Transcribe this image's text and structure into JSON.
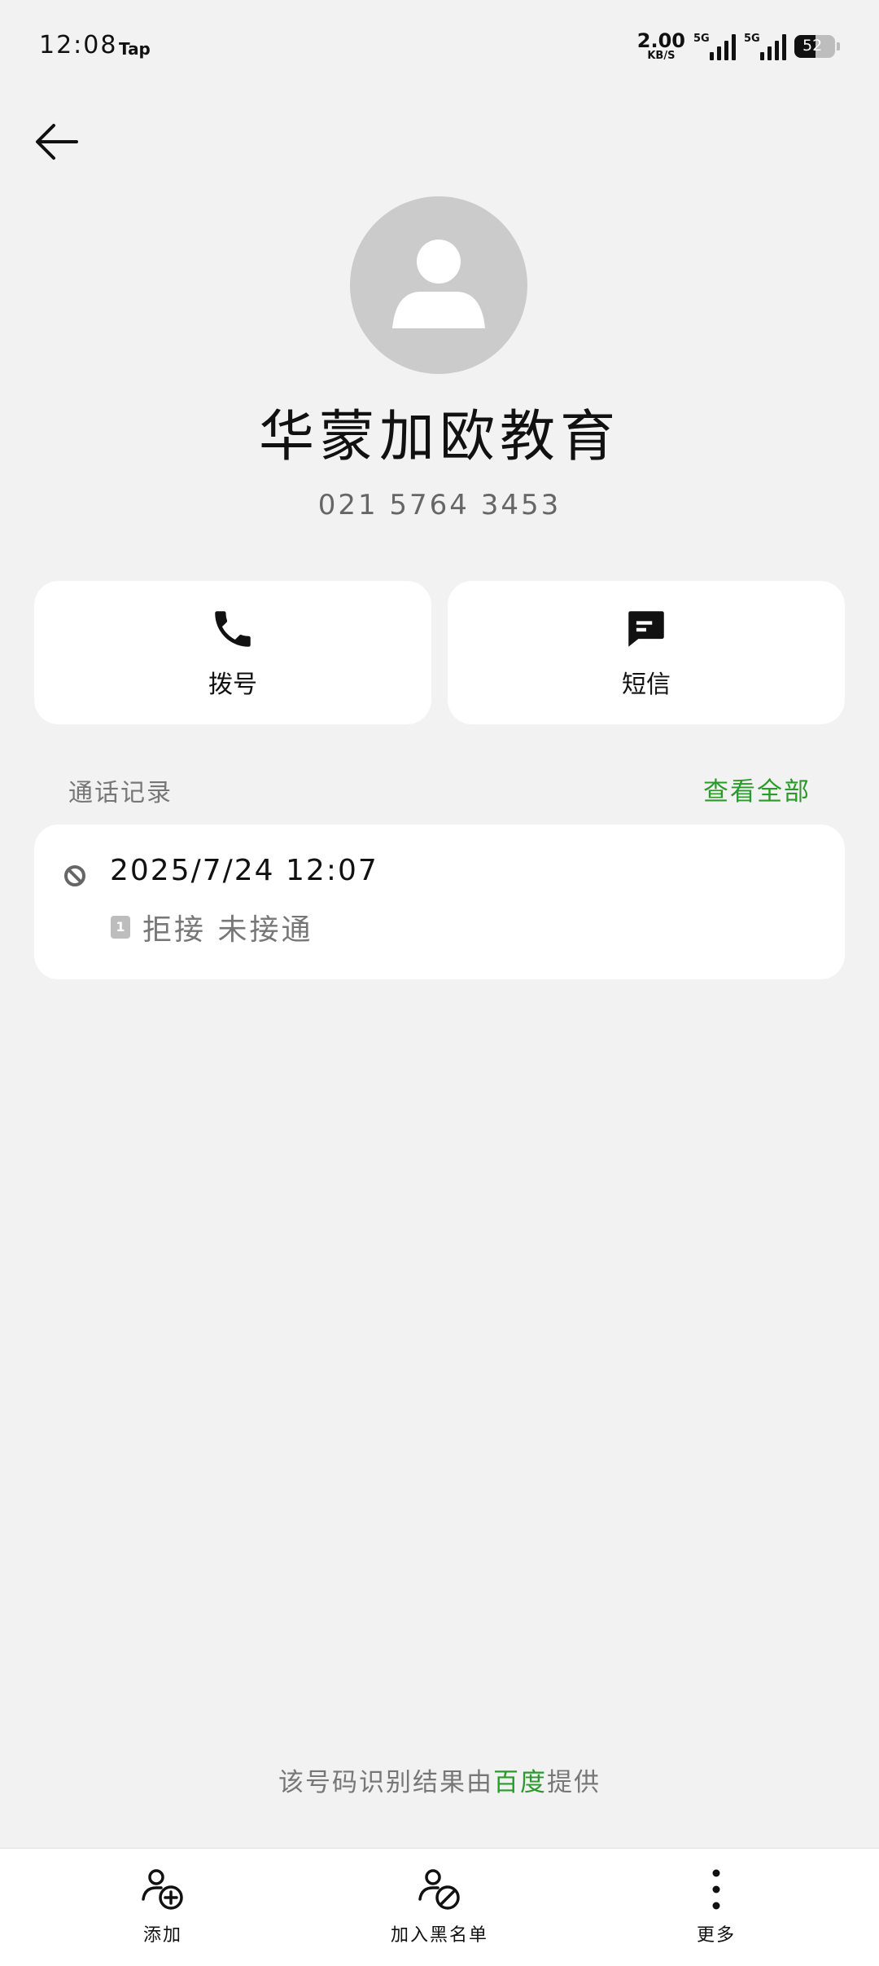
{
  "status_bar": {
    "time": "12:08",
    "app_label": "Tap",
    "net_speed_value": "2.00",
    "net_speed_unit": "KB/S",
    "signal_1_label": "5G",
    "signal_2_label": "5G",
    "battery_level": "52",
    "battery_percent": 52
  },
  "contact": {
    "name": "华蒙加欧教育",
    "number": "021 5764 3453"
  },
  "actions": {
    "call_label": "拨号",
    "message_label": "短信"
  },
  "call_log": {
    "section_title": "通话记录",
    "view_all_label": "查看全部",
    "entries": [
      {
        "datetime": "2025/7/24 12:07",
        "sim": "1",
        "status": "拒接 未接通"
      }
    ]
  },
  "provider": {
    "prefix": "该号码识别结果由",
    "name": "百度",
    "suffix": "提供"
  },
  "bottom_bar": {
    "add_label": "添加",
    "block_label": "加入黑名单",
    "more_label": "更多"
  },
  "colors": {
    "accent": "#2a9a2a",
    "background": "#f2f2f2",
    "card": "#ffffff",
    "avatar": "#cbcbcb"
  }
}
